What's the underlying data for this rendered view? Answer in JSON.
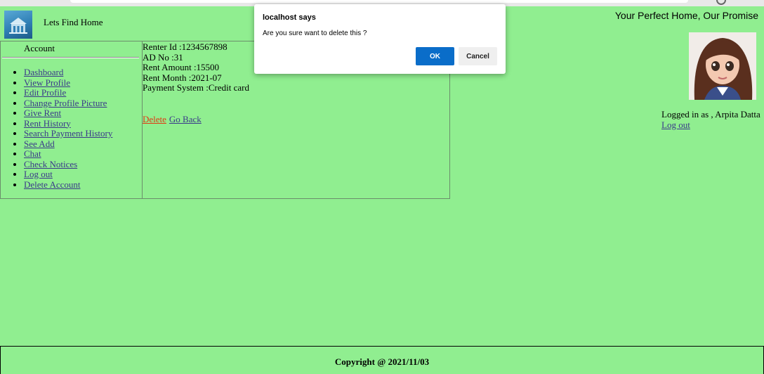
{
  "header": {
    "site_title": "Lets Find Home",
    "tagline": "Your Perfect Home, Our Promise",
    "logo_icon": "building-icon"
  },
  "user": {
    "logged_in_text": "Logged in as , Arpita Datta",
    "logout_label": "Log out"
  },
  "sidebar": {
    "title": "Account",
    "items": [
      {
        "label": "Dashboard"
      },
      {
        "label": "View Profile"
      },
      {
        "label": "Edit Profile"
      },
      {
        "label": "Change Profile Picture"
      },
      {
        "label": "Give Rent"
      },
      {
        "label": "Rent History"
      },
      {
        "label": "Search Payment History"
      },
      {
        "label": "See Add"
      },
      {
        "label": "Chat"
      },
      {
        "label": "Check Notices"
      },
      {
        "label": "Log out"
      },
      {
        "label": "Delete Account"
      }
    ]
  },
  "details": {
    "renter_id": "Renter Id :1234567898",
    "ad_no": "AD No :31",
    "rent_amount": "Rent Amount :15500",
    "rent_month": "Rent Month :2021-07",
    "payment_system": "Payment System :Credit card"
  },
  "actions": {
    "delete_label": "Delete",
    "goback_label": "Go Back"
  },
  "dialog": {
    "title": "localhost says",
    "message": "Are you sure want to delete this ?",
    "ok_label": "OK",
    "cancel_label": "Cancel"
  },
  "footer": {
    "copyright": "Copyright @ 2021/11/03"
  },
  "colors": {
    "background": "#90ee90",
    "link": "#3a3a8a",
    "delete_link": "#e03a14",
    "ok_button": "#0a6dc9"
  }
}
